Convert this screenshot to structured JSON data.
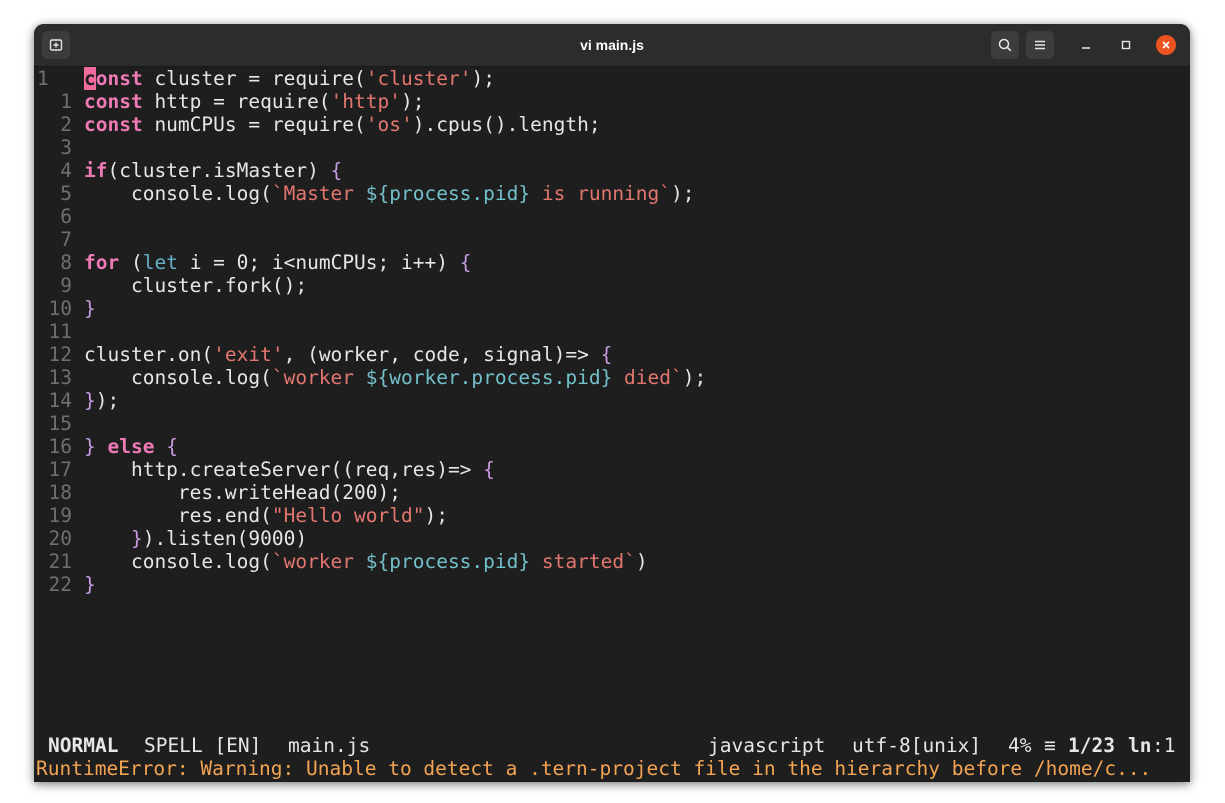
{
  "window": {
    "title": "vi main.js",
    "accent": "#e95420",
    "icons": [
      "new-tab-icon",
      "search-icon",
      "hamburger-menu-icon",
      "minimize-icon",
      "maximize-icon",
      "close-icon"
    ]
  },
  "editor": {
    "lines": [
      {
        "num": "1",
        "segs": [
          {
            "t": "c",
            "c": "cursor"
          },
          {
            "t": "onst",
            "c": "k"
          },
          {
            "t": " cluster = require("
          },
          {
            "t": "'cluster'",
            "c": "s"
          },
          {
            "t": ");"
          }
        ]
      },
      {
        "num": "1",
        "segs": [
          {
            "t": "const",
            "c": "k"
          },
          {
            "t": " http = require("
          },
          {
            "t": "'http'",
            "c": "s"
          },
          {
            "t": ");"
          }
        ]
      },
      {
        "num": "2",
        "segs": [
          {
            "t": "const",
            "c": "k"
          },
          {
            "t": " numCPUs = require("
          },
          {
            "t": "'os'",
            "c": "s"
          },
          {
            "t": ").cpus().length;"
          }
        ]
      },
      {
        "num": "3",
        "segs": []
      },
      {
        "num": "4",
        "segs": [
          {
            "t": "if",
            "c": "k"
          },
          {
            "t": "(cluster.isMaster) "
          },
          {
            "t": "{",
            "c": "p"
          }
        ]
      },
      {
        "num": "5",
        "segs": [
          {
            "t": "    console.log("
          },
          {
            "t": "`Master ",
            "c": "s"
          },
          {
            "t": "${process.pid}",
            "c": "i"
          },
          {
            "t": " is running",
            "c": "s"
          },
          {
            "t": "`",
            "c": "s"
          },
          {
            "t": ");"
          }
        ]
      },
      {
        "num": "6",
        "segs": []
      },
      {
        "num": "7",
        "segs": []
      },
      {
        "num": "8",
        "segs": [
          {
            "t": "for",
            "c": "k"
          },
          {
            "t": " ("
          },
          {
            "t": "let",
            "c": "kt"
          },
          {
            "t": " i = 0; i<numCPUs; i++) "
          },
          {
            "t": "{",
            "c": "p"
          }
        ]
      },
      {
        "num": "9",
        "segs": [
          {
            "t": "    cluster.fork();"
          }
        ]
      },
      {
        "num": "10",
        "segs": [
          {
            "t": "}",
            "c": "p"
          }
        ]
      },
      {
        "num": "11",
        "segs": []
      },
      {
        "num": "12",
        "segs": [
          {
            "t": "cluster.on("
          },
          {
            "t": "'exit'",
            "c": "s"
          },
          {
            "t": ", (worker, code, signal)=> "
          },
          {
            "t": "{",
            "c": "p"
          }
        ]
      },
      {
        "num": "13",
        "segs": [
          {
            "t": "    console.log("
          },
          {
            "t": "`worker ",
            "c": "s"
          },
          {
            "t": "${worker.process.pid}",
            "c": "i"
          },
          {
            "t": " died",
            "c": "s"
          },
          {
            "t": "`",
            "c": "s"
          },
          {
            "t": ");"
          }
        ]
      },
      {
        "num": "14",
        "segs": [
          {
            "t": "}",
            "c": "p"
          },
          {
            "t": ");"
          }
        ]
      },
      {
        "num": "15",
        "segs": []
      },
      {
        "num": "16",
        "segs": [
          {
            "t": "}",
            "c": "p"
          },
          {
            "t": " "
          },
          {
            "t": "else",
            "c": "k"
          },
          {
            "t": " "
          },
          {
            "t": "{",
            "c": "p"
          }
        ]
      },
      {
        "num": "17",
        "segs": [
          {
            "t": "    http.createServer((req,res)=> "
          },
          {
            "t": "{",
            "c": "p"
          }
        ]
      },
      {
        "num": "18",
        "segs": [
          {
            "t": "        res.writeHead(200);"
          }
        ]
      },
      {
        "num": "19",
        "segs": [
          {
            "t": "        res.end("
          },
          {
            "t": "\"Hello world\"",
            "c": "s"
          },
          {
            "t": ");"
          }
        ]
      },
      {
        "num": "20",
        "segs": [
          {
            "t": "    }",
            "c": "p"
          },
          {
            "t": ").listen(9000)"
          }
        ]
      },
      {
        "num": "21",
        "segs": [
          {
            "t": "    console.log("
          },
          {
            "t": "`worker ",
            "c": "s"
          },
          {
            "t": "${process.pid}",
            "c": "i"
          },
          {
            "t": " started",
            "c": "s"
          },
          {
            "t": "`",
            "c": "s"
          },
          {
            "t": ")"
          }
        ]
      },
      {
        "num": "22",
        "segs": [
          {
            "t": "}",
            "c": "p"
          }
        ]
      }
    ]
  },
  "statusline": {
    "mode": "NORMAL",
    "spell": "SPELL [EN]",
    "filename": "main.js",
    "filetype": "javascript",
    "encoding": "utf-8[unix]",
    "percent": "4%",
    "symbol": "≡",
    "position": "1/23",
    "ln_symbol": "ln",
    "column": ":1"
  },
  "message": "RuntimeError: Warning: Unable to detect a .tern-project file in the hierarchy before /home/c..."
}
